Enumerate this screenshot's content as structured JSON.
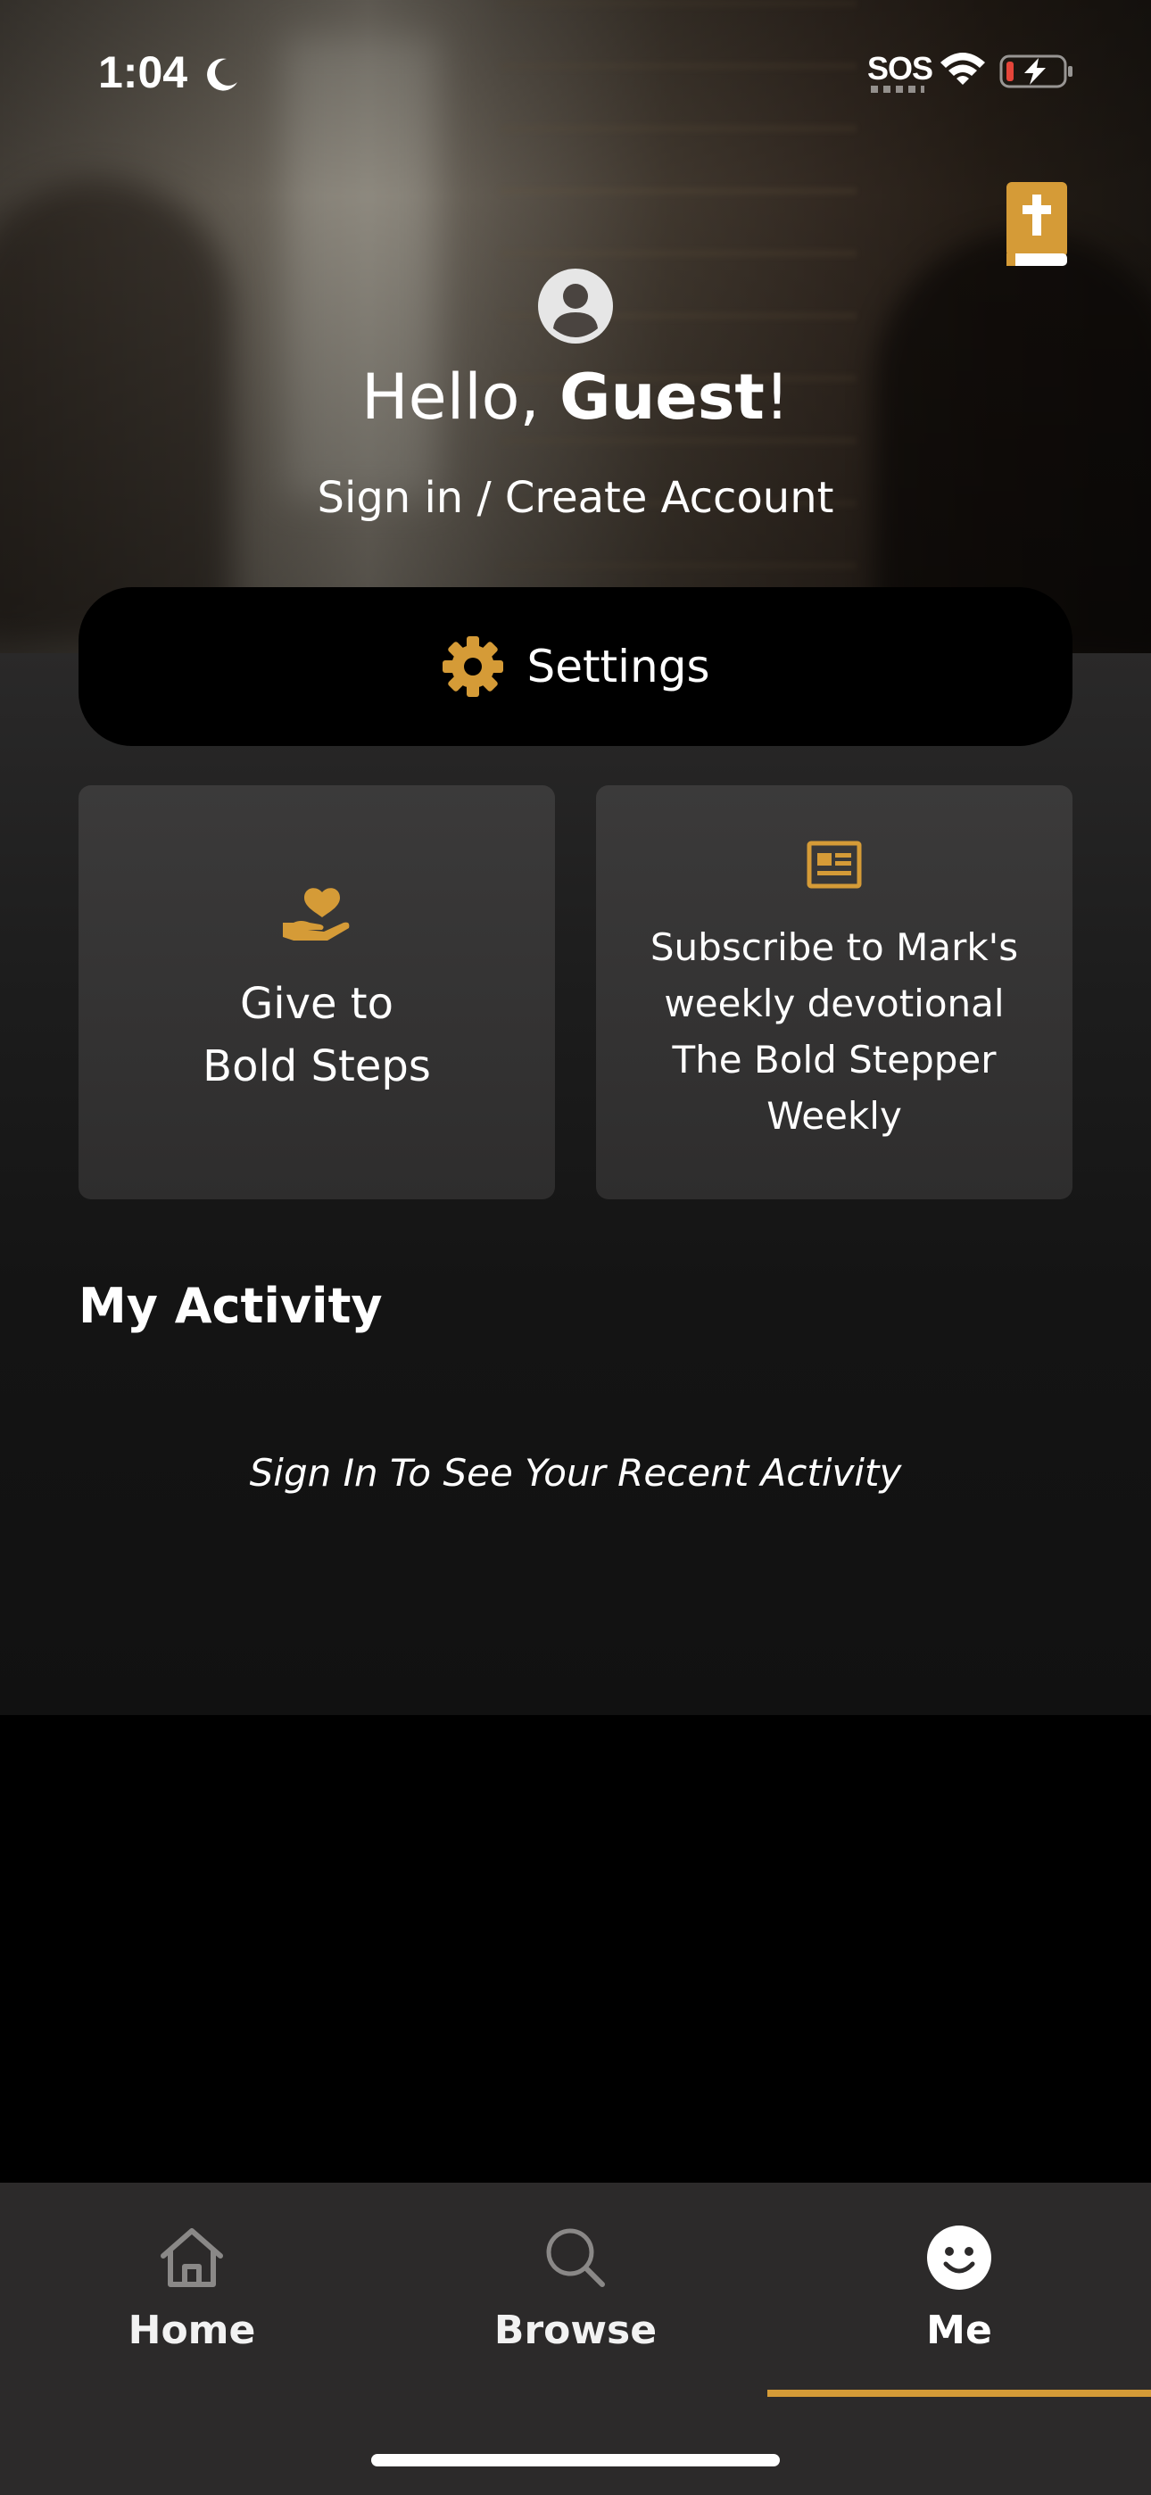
{
  "status_bar": {
    "time": "1:04",
    "carrier": "SOS"
  },
  "header": {
    "greeting_prefix": "Hello, ",
    "greeting_name": "Guest",
    "greeting_suffix": "!",
    "signin_label": "Sign in / Create Account"
  },
  "settings": {
    "label": "Settings"
  },
  "cards": {
    "give": {
      "line1": "Give to",
      "line2": "Bold Steps"
    },
    "subscribe": {
      "line1": "Subscribe to Mark's",
      "line2": "weekly devotional",
      "line3": "The Bold Stepper",
      "line4": "Weekly"
    }
  },
  "activity": {
    "title": "My Activity",
    "empty_message": "Sign In To See Your Recent Activity"
  },
  "tabbar": {
    "tabs": [
      {
        "label": "Home",
        "icon": "home-icon"
      },
      {
        "label": "Browse",
        "icon": "search-icon"
      },
      {
        "label": "Me",
        "icon": "smiley-icon"
      }
    ],
    "active_tab": "Me"
  },
  "colors": {
    "accent": "#d59b37",
    "tabbar_bg": "#2c2a2a",
    "card_bg": "#353434"
  }
}
